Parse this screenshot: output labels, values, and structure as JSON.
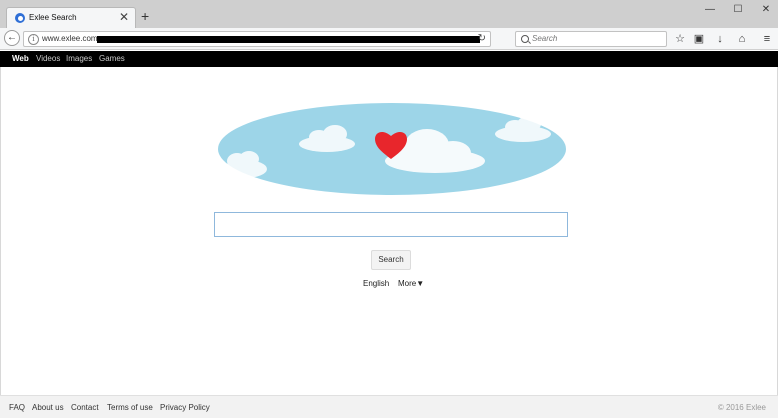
{
  "browser": {
    "tab_title": "Exlee Search",
    "tab_close": "✕",
    "new_tab": "+",
    "window_buttons": {
      "minimize": "—",
      "maximize": "☐",
      "close": "✕"
    },
    "back_icon": "←",
    "url": "www.exlee.com",
    "reload_icon": "↻",
    "search_placeholder": "Search",
    "toolbar_icons": {
      "bookmark": "☆",
      "library": "▣",
      "download": "↓",
      "home": "⌂",
      "menu": "≡"
    }
  },
  "site_nav": {
    "items": [
      {
        "label": "Web",
        "active": true
      },
      {
        "label": "Videos",
        "active": false
      },
      {
        "label": "Images",
        "active": false
      },
      {
        "label": "Games",
        "active": false
      }
    ]
  },
  "main": {
    "search_value": "",
    "search_button": "Search",
    "language": "English",
    "more": "More▼"
  },
  "footer": {
    "links": [
      "FAQ",
      "About us",
      "Contact",
      "Terms of use",
      "Privacy Policy"
    ],
    "copyright": "© 2016 Exlee"
  },
  "colors": {
    "logo_sky": "#9dd5e8",
    "heart": "#e8262c",
    "nav_background": "#000000",
    "search_border": "#8fb8dc"
  }
}
